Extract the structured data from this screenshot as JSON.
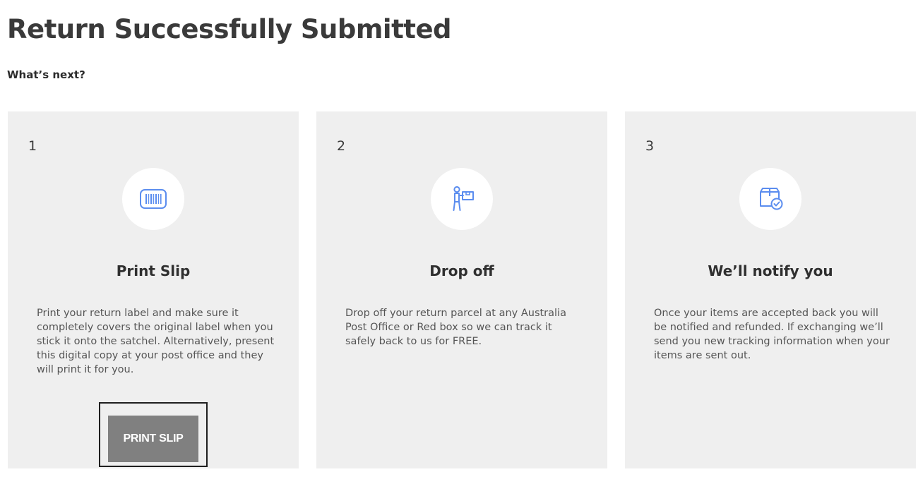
{
  "page": {
    "title": "Return Successfully Submitted",
    "subtitle": "What’s next?"
  },
  "steps": [
    {
      "number": "1",
      "icon": "barcode-icon",
      "title": "Print Slip",
      "description": "Print your return label and make sure it completely covers the original label when you stick it onto the satchel. Alternatively, present this digital copy at your post office and they will print it for you.",
      "button_label": "PRINT SLIP"
    },
    {
      "number": "2",
      "icon": "person-carrying-box-icon",
      "title": "Drop off",
      "description": "Drop off your return parcel at any Australia Post Office or Red box so we can track it safely back to us for FREE."
    },
    {
      "number": "3",
      "icon": "package-check-icon",
      "title": "We’ll notify you",
      "description": "Once your items are accepted back you will be notified and refunded. If exchanging we’ll send you new tracking information when your items are sent out."
    }
  ],
  "colors": {
    "card_background": "#efefef",
    "icon_accent": "#5b8def",
    "button_background": "#808080",
    "button_text": "#ffffff"
  }
}
